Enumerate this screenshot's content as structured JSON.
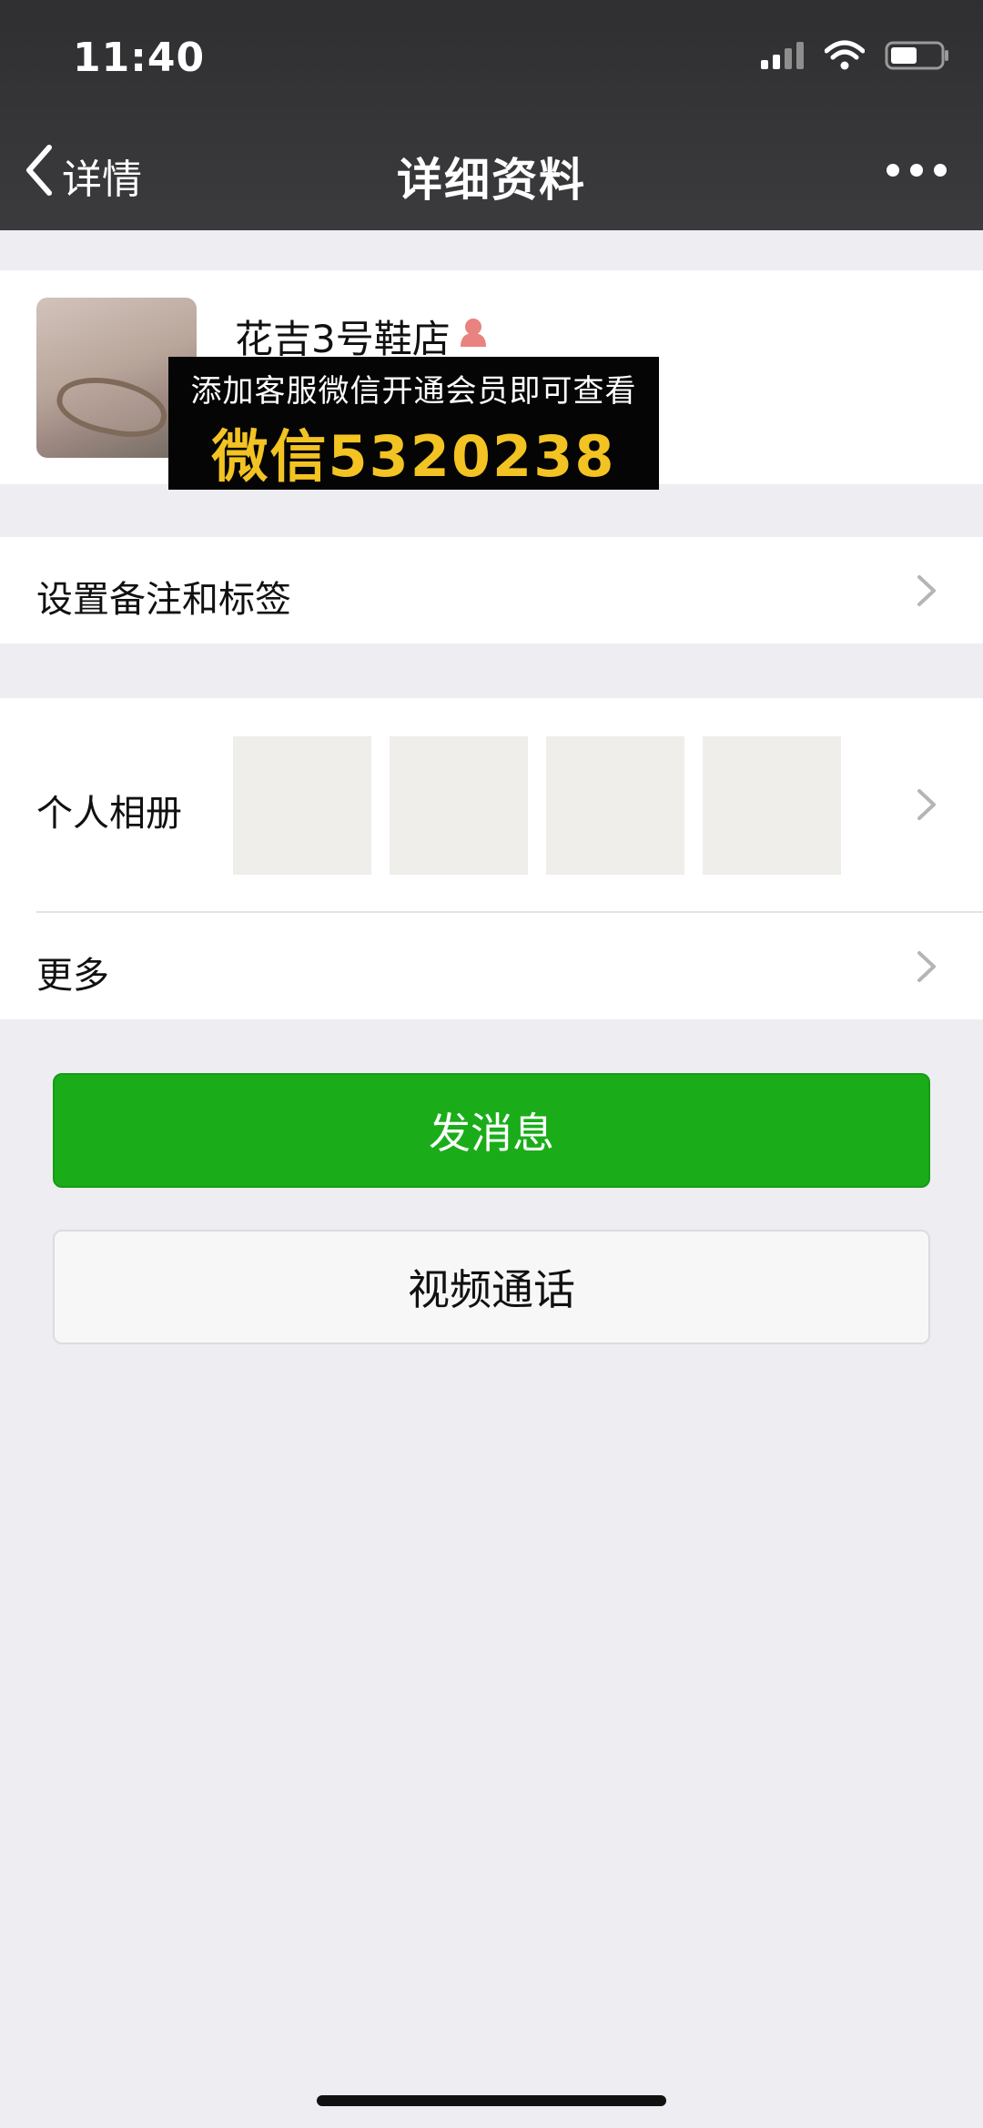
{
  "status_bar": {
    "time": "11:40"
  },
  "nav": {
    "back_label": "详情",
    "title": "详细资料"
  },
  "profile": {
    "name": "花吉3号鞋店"
  },
  "watermark": {
    "line1": "添加客服微信开通会员即可查看",
    "line2": "微信5320238"
  },
  "rows": {
    "remark_label": "设置备注和标签",
    "album_label": "个人相册",
    "more_label": "更多"
  },
  "buttons": {
    "send_message": "发消息",
    "video_call": "视频通话"
  },
  "colors": {
    "primary_green": "#1aad19",
    "watermark_yellow": "#f2c322",
    "nav_bg": "#363638"
  }
}
